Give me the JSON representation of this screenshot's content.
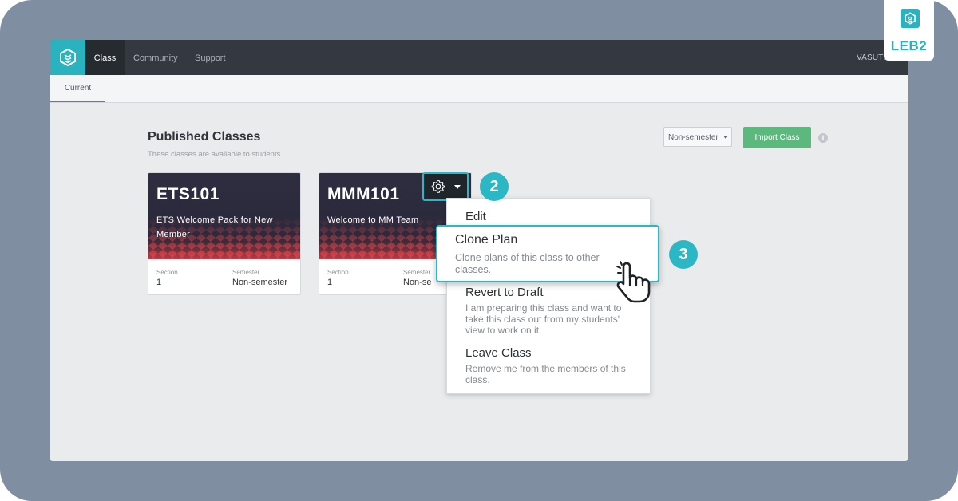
{
  "nav": {
    "items": [
      {
        "label": "Class",
        "active": true
      },
      {
        "label": "Community",
        "active": false
      },
      {
        "label": "Support",
        "active": false
      }
    ],
    "user": "VASUTHI"
  },
  "subnav": {
    "tab": "Current"
  },
  "section": {
    "title": "Published Classes",
    "subtitle": "These classes are available to students."
  },
  "toolbar": {
    "semester_select": "Non-semester",
    "import_label": "Import Class",
    "info_glyph": "i"
  },
  "cards": [
    {
      "code": "ETS101",
      "desc": "ETS Welcome Pack for New Member",
      "section_label": "Section",
      "section_value": "1",
      "semester_label": "Semester",
      "semester_value": "Non-semester"
    },
    {
      "code": "MMM101",
      "desc": "Welcome to MM Team",
      "section_label": "Section",
      "section_value": "1",
      "semester_label": "Semester",
      "semester_value": "Non-se"
    }
  ],
  "menu": {
    "edit": "Edit",
    "clone_title": "Clone Plan",
    "clone_desc": "Clone plans of this class to other classes.",
    "revert_title": "Revert to Draft",
    "revert_desc": "I am preparing this class and want to take this class out from my students' view to work on it.",
    "leave_title": "Leave Class",
    "leave_desc": "Remove me from the members of this class."
  },
  "steps": [
    "2",
    "3"
  ],
  "brand": {
    "text": "LEB2"
  },
  "colors": {
    "accent": "#2bb7c3",
    "nav": "#33393f",
    "import": "#5cb97d"
  }
}
